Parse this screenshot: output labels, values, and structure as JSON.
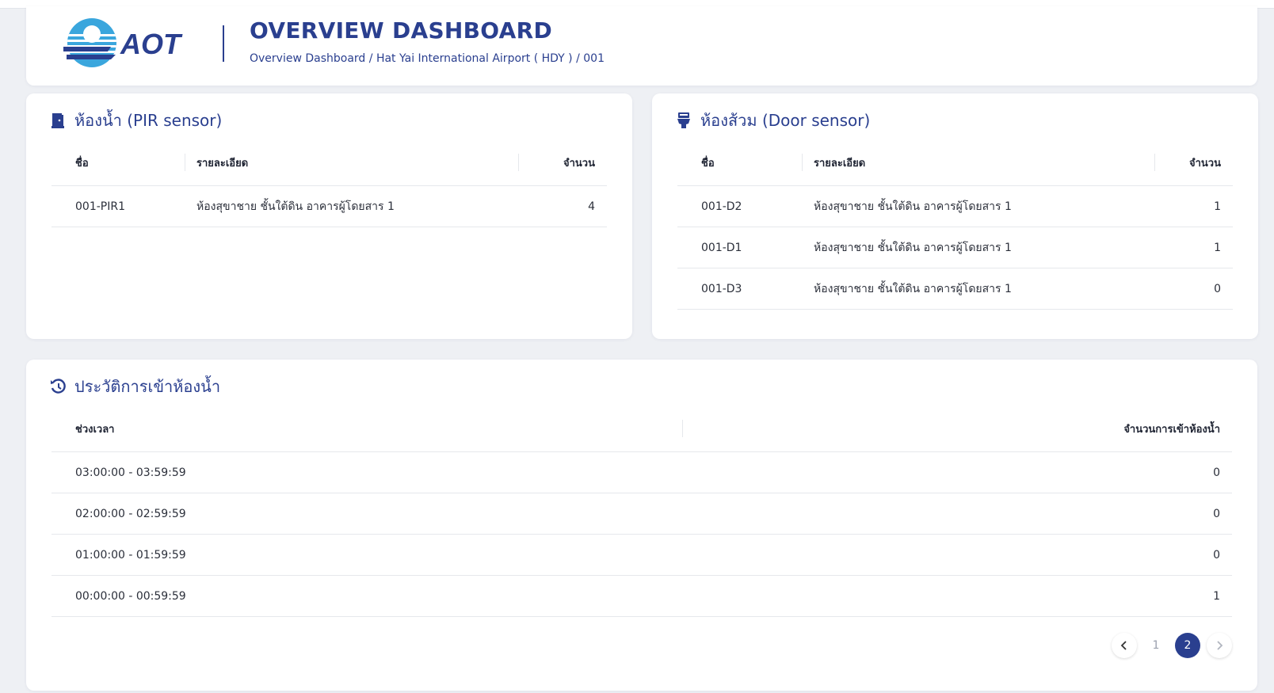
{
  "header": {
    "title": "OVERVIEW DASHBOARD",
    "breadcrumb": [
      "Overview Dashboard",
      "Hat Yai International Airport ( HDY )",
      "001"
    ],
    "breadcrumb_sep": " / ",
    "logo_text": "AOT"
  },
  "pir": {
    "title": "ห้องน้ำ (PIR sensor)",
    "icon": "door-icon",
    "columns": [
      "ชื่อ",
      "รายละเอียด",
      "จำนวน"
    ],
    "rows": [
      {
        "name": "001-PIR1",
        "detail": "ห้องสุขาชาย ชั้นใต้ดิน อาคารผู้โดยสาร 1",
        "qty": "4"
      }
    ]
  },
  "door": {
    "title": "ห้องส้วม (Door sensor)",
    "icon": "toilet-icon",
    "columns": [
      "ชื่อ",
      "รายละเอียด",
      "จำนวน"
    ],
    "rows": [
      {
        "name": "001-D2",
        "detail": "ห้องสุขาชาย ชั้นใต้ดิน อาคารผู้โดยสาร 1",
        "qty": "1"
      },
      {
        "name": "001-D1",
        "detail": "ห้องสุขาชาย ชั้นใต้ดิน อาคารผู้โดยสาร 1",
        "qty": "1"
      },
      {
        "name": "001-D3",
        "detail": "ห้องสุขาชาย ชั้นใต้ดิน อาคารผู้โดยสาร 1",
        "qty": "0"
      }
    ]
  },
  "history": {
    "title": "ประวัติการเข้าห้องน้ำ",
    "icon": "history-icon",
    "columns": [
      "ช่วงเวลา",
      "จำนวนการเข้าห้องน้ำ"
    ],
    "rows": [
      {
        "time": "03:00:00 - 03:59:59",
        "count": "0"
      },
      {
        "time": "02:00:00 - 02:59:59",
        "count": "0"
      },
      {
        "time": "01:00:00 - 01:59:59",
        "count": "0"
      },
      {
        "time": "00:00:00 - 00:59:59",
        "count": "1"
      }
    ],
    "pagination": {
      "prev": "‹",
      "pages": [
        "1",
        "2"
      ],
      "current": "2",
      "next": "›"
    }
  },
  "colors": {
    "primary": "#2a3f8f",
    "logo_blue": "#3aa6dd",
    "background": "#eef0f4"
  }
}
